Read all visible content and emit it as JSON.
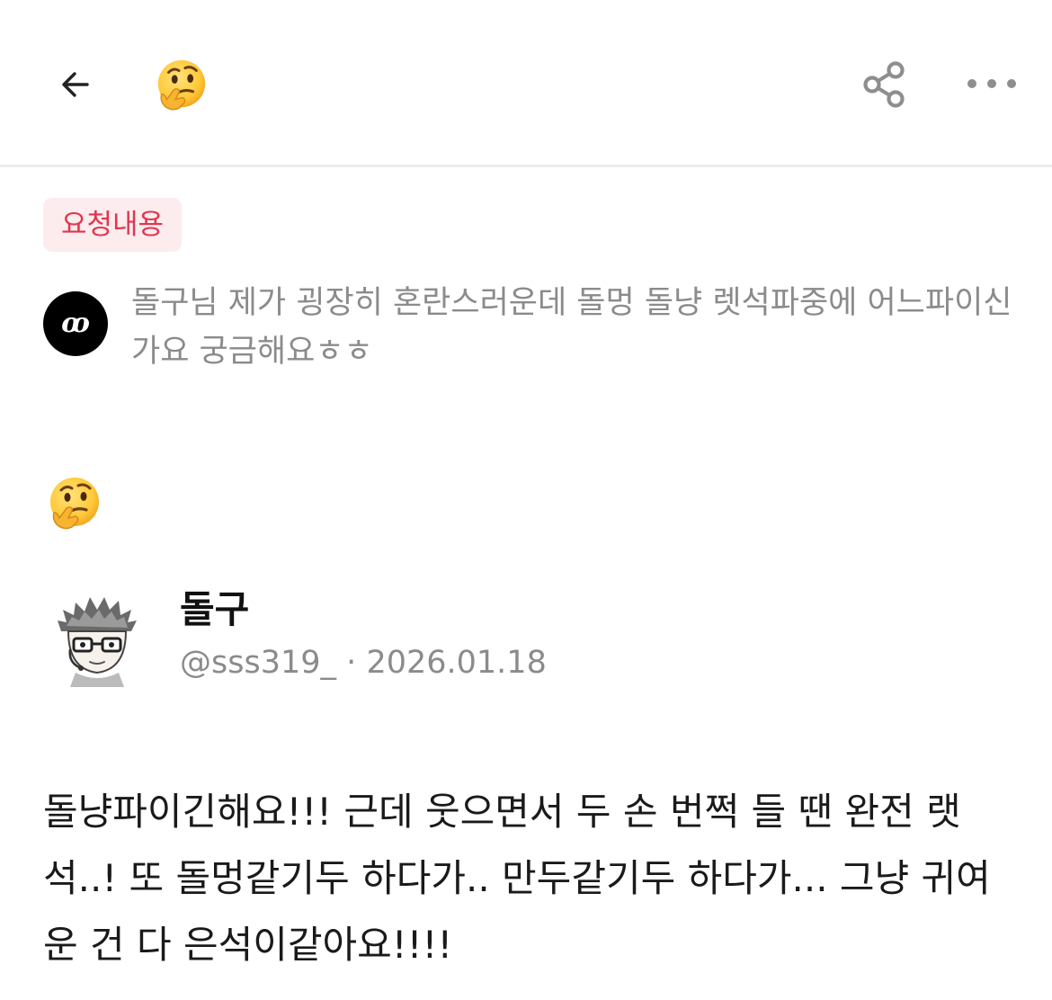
{
  "header": {
    "back_icon": "arrow-left-icon",
    "emoji": "thinking-face-emoji",
    "share_icon": "share-icon",
    "more_icon": "more-horizontal-icon"
  },
  "request": {
    "tag_label": "요청내용",
    "tag_color": "#e0364f",
    "tag_bg": "#fdecee",
    "asker_avatar_text": "ꝏ",
    "text": "돌구님 제가 굉장히 혼란스러운데 돌멍 돌냥 렛석파중에 어느파이신가요 궁금해요ㅎㅎ"
  },
  "response": {
    "emoji": "thinking-face-emoji",
    "author_name": "돌구",
    "author_handle": "@sss319_",
    "separator": "·",
    "date": "2026.01.18",
    "text": "돌냥파이긴해요!!! 근데 웃으면서 두 손 번쩍 들 땐 완전 랫석..! 또 돌멍같기두 하다가.. 만두같기두 하다가... 그냥 귀여운 건 다 은석이같아요!!!!"
  }
}
